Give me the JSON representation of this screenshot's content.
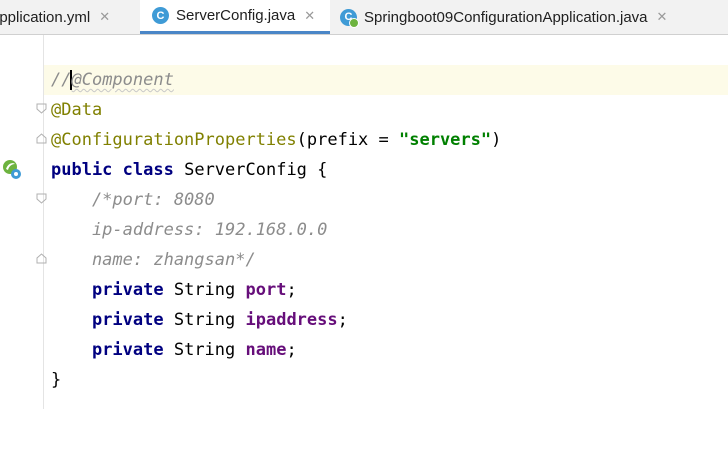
{
  "tabs": [
    {
      "label": "application.yml",
      "icon": "yaml-file-icon",
      "active": false
    },
    {
      "label": "ServerConfig.java",
      "icon": "java-class-icon",
      "active": true
    },
    {
      "label": "Springboot09ConfigurationApplication.java",
      "icon": "spring-boot-class-icon",
      "active": false
    }
  ],
  "close_glyph": "✕",
  "class_icon_letter": "C",
  "code": {
    "l1_comment": "//",
    "l1_annotation": "@Component",
    "l2": "@Data",
    "l3_annotation": "@ConfigurationProperties",
    "l3_open": "(prefix = ",
    "l3_string": "\"servers\"",
    "l3_close": ")",
    "l4_public": "public",
    "l4_class": "class",
    "l4_name": " ServerConfig {",
    "l5": "    /*port: 8080",
    "l6": "    ip-address: 192.168.0.0",
    "l7": "    name: zhangsan*/",
    "kw_private": "private",
    "type_string": " String ",
    "field1": "port",
    "field2": "ipaddress",
    "field3": "name",
    "semicolon": ";",
    "closing_brace": "}"
  },
  "colors": {
    "keyword": "#000080",
    "annotation": "#808000",
    "string": "#008000",
    "comment": "#8c8c8c",
    "field": "#660e7a",
    "tab_underline": "#4a86c7",
    "current_line": "#fdfbe8"
  }
}
